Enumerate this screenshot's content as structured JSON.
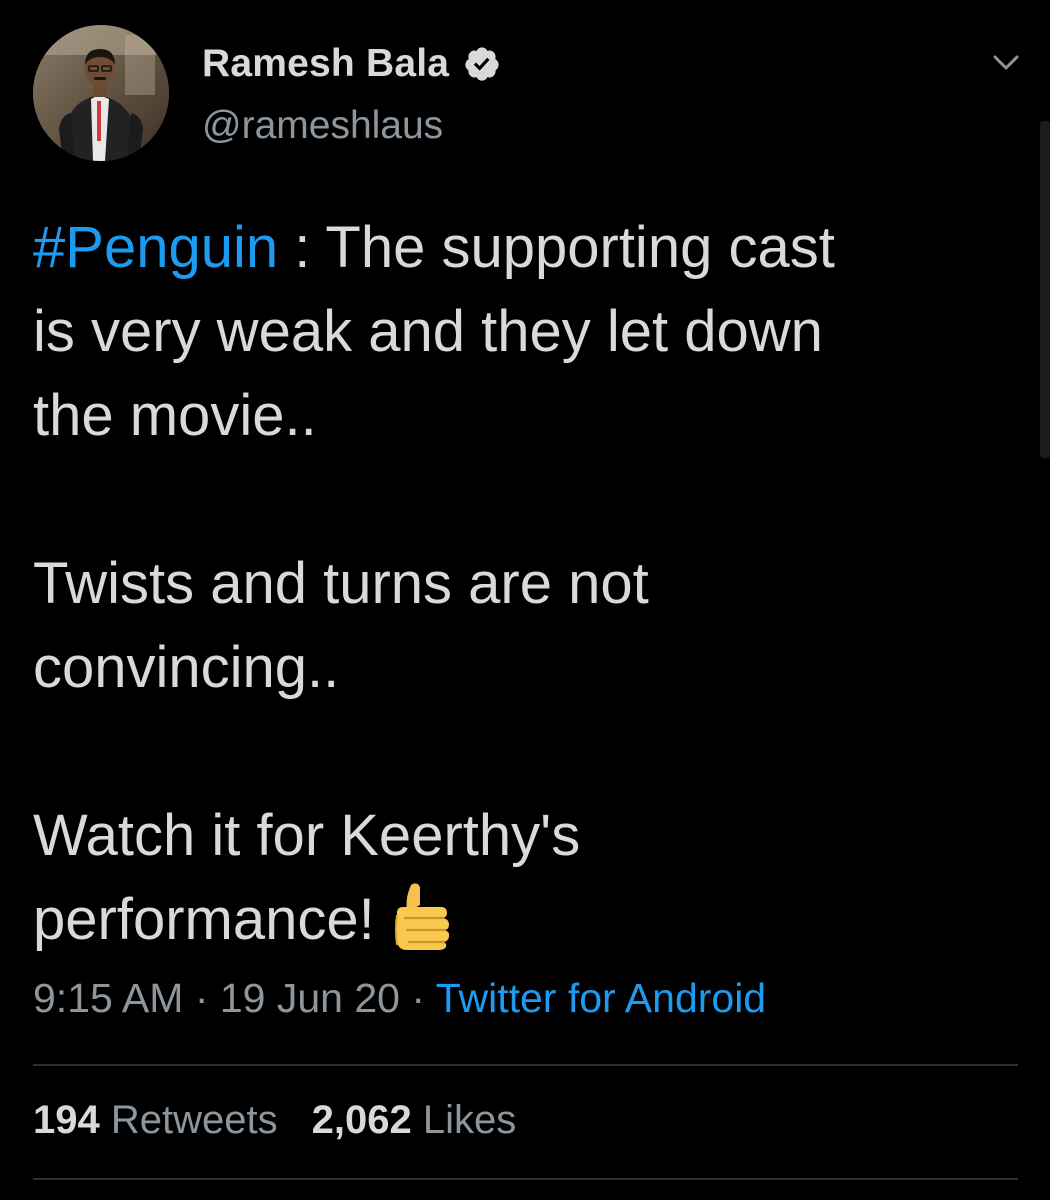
{
  "author": {
    "display_name": "Ramesh Bala",
    "handle": "@rameshlaus",
    "verified": true
  },
  "tweet": {
    "hashtag": "#Penguin",
    "text_after_hashtag": " : The supporting cast",
    "line2": "is very weak and they let down",
    "line3": "the movie..",
    "line4": "Twists and turns are not",
    "line5": "convincing..",
    "line6": "Watch it for Keerthy's",
    "line7": "performance!",
    "emoji": "thumbs-up"
  },
  "meta": {
    "time": "9:15 AM",
    "sep1": " · ",
    "date": "19 Jun 20",
    "sep2": " · ",
    "source": "Twitter for Android"
  },
  "stats": {
    "retweets_count": "194",
    "retweets_label": " Retweets",
    "likes_count": "2,062",
    "likes_label": " Likes"
  },
  "colors": {
    "background": "#000000",
    "text": "#d9d9d9",
    "secondary": "#8e969d",
    "accent": "#1d9bf0"
  }
}
